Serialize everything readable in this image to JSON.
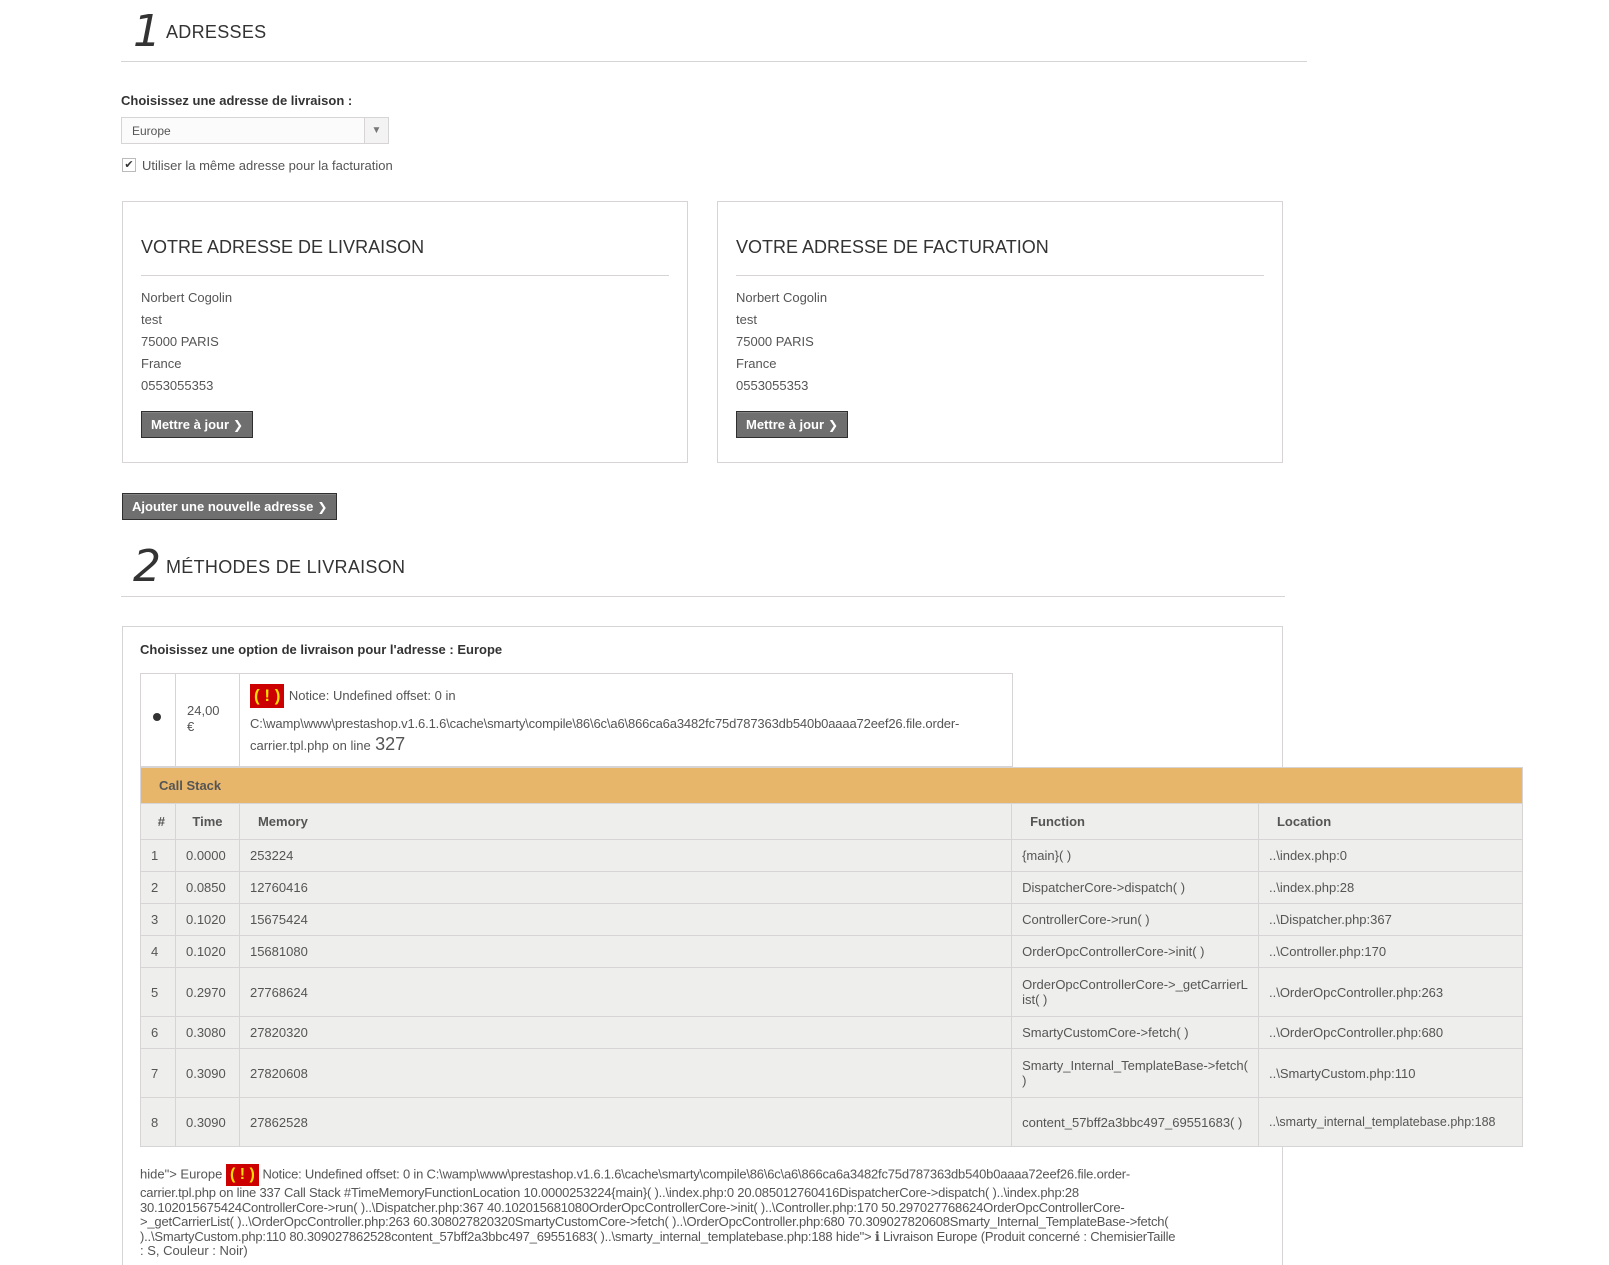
{
  "step1": {
    "number": "1",
    "title": "ADRESSES"
  },
  "address_select": {
    "label": "Choisissez une adresse de livraison :",
    "value": "Europe",
    "same_billing_label": "Utiliser la même adresse pour la facturation",
    "same_billing_checked": true
  },
  "delivery_address": {
    "title": "VOTRE ADRESSE DE LIVRAISON",
    "lines": [
      "Norbert Cogolin",
      "test",
      "75000 PARIS",
      "France",
      "0553055353"
    ],
    "update_label": "Mettre à jour"
  },
  "billing_address": {
    "title": "VOTRE ADRESSE DE FACTURATION",
    "lines": [
      "Norbert Cogolin",
      "test",
      "75000 PARIS",
      "France",
      "0553055353"
    ],
    "update_label": "Mettre à jour"
  },
  "add_address_label": "Ajouter une nouvelle adresse",
  "step2": {
    "number": "2",
    "title": "MÉTHODES DE LIVRAISON"
  },
  "carrier": {
    "heading": "Choisissez une option de livraison pour l'adresse : Europe",
    "price_line1": "24,00",
    "price_line2": "€",
    "notice_badge": "( ! )",
    "notice_text": "Notice: Undefined offset: 0 in",
    "notice_path": "C:\\wamp\\www\\prestashop.v1.6.1.6\\cache\\smarty\\compile\\86\\6c\\a6\\866ca6a3482fc75d787363db540b0aaaa72eef26.file.order-",
    "notice_path2": "carrier.tpl.php on line",
    "notice_line": "327"
  },
  "call_stack": {
    "title": "Call Stack",
    "headers": [
      "#",
      "Time",
      "Memory",
      "Function",
      "Location"
    ],
    "rows": [
      [
        "1",
        "0.0000",
        "253224",
        "{main}( )",
        "..\\index.php:0"
      ],
      [
        "2",
        "0.0850",
        "12760416",
        "DispatcherCore->dispatch( )",
        "..\\index.php:28"
      ],
      [
        "3",
        "0.1020",
        "15675424",
        "ControllerCore->run( )",
        "..\\Dispatcher.php:367"
      ],
      [
        "4",
        "0.1020",
        "15681080",
        "OrderOpcControllerCore->init( )",
        "..\\Controller.php:170"
      ],
      [
        "5",
        "0.2970",
        "27768624",
        "OrderOpcControllerCore->_getCarrierList( )",
        "..\\OrderOpcController.php:263"
      ],
      [
        "6",
        "0.3080",
        "27820320",
        "SmartyCustomCore->fetch( )",
        "..\\OrderOpcController.php:680"
      ],
      [
        "7",
        "0.3090",
        "27820608",
        "Smarty_Internal_TemplateBase->fetch( )",
        "..\\SmartyCustom.php:110"
      ],
      [
        "8",
        "0.3090",
        "27862528",
        "content_57bff2a3bbc497_69551683( )",
        "..\\smarty_internal_templatebase.php:188"
      ]
    ]
  },
  "bottom_notice": {
    "prefix": "hide\"> Europe",
    "badge": "( ! )",
    "line1": "Notice: Undefined offset: 0 in C:\\wamp\\www\\prestashop.v1.6.1.6\\cache\\smarty\\compile\\86\\6c\\a6\\866ca6a3482fc75d787363db540b0aaaa72eef26.file.order-",
    "line2": "carrier.tpl.php on line 337 Call Stack #TimeMemoryFunctionLocation 10.0000253224{main}( )..\\index.php:0 20.085012760416DispatcherCore->dispatch( )..\\index.php:28",
    "line3": "30.102015675424ControllerCore->run( )..\\Dispatcher.php:367 40.102015681080OrderOpcControllerCore->init( )..\\Controller.php:170 50.297027768624OrderOpcControllerCore-",
    "line4": ">_getCarrierList( )..\\OrderOpcController.php:263 60.308027820320SmartyCustomCore->fetch( )..\\OrderOpcController.php:680 70.309027820608Smarty_Internal_TemplateBase->fetch(",
    "line5": ")..\\SmartyCustom.php:110 80.309027862528content_57bff2a3bbc497_69551683( )..\\smarty_internal_templatebase.php:188 hide\"> ℹ Livraison Europe (Produit concerné : ChemisierTaille",
    "line6": ": S, Couleur : Noir)"
  }
}
